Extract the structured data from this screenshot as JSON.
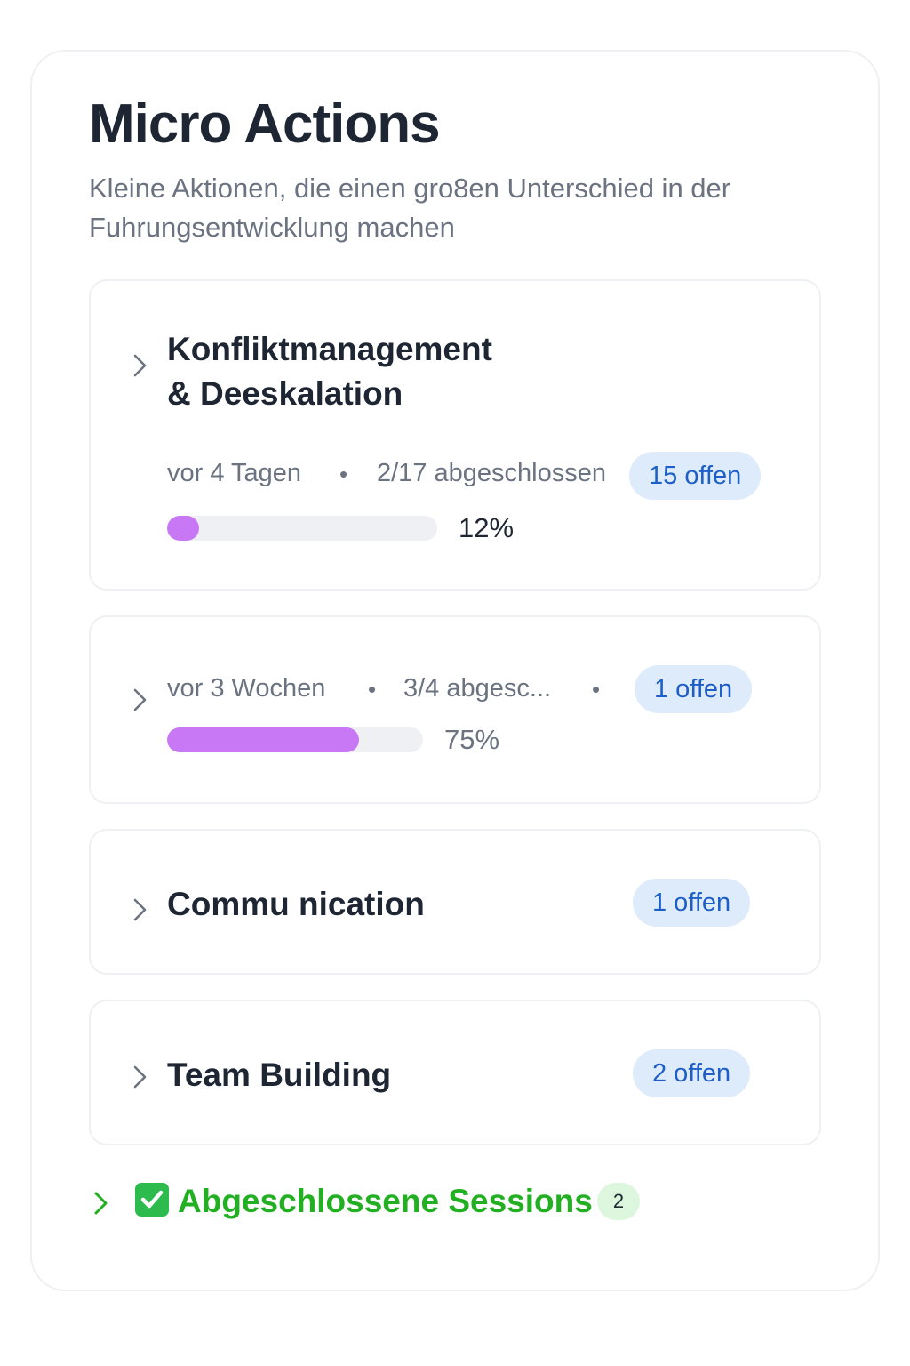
{
  "header": {
    "title": "Micro Actions",
    "subtitle": "Kleine Aktionen, die einen gro8en Unterschied in der Fuhrungsentwicklung machen"
  },
  "sessions": [
    {
      "title_line1": "Konfliktmanagement",
      "title_line2": "& Deeskalation",
      "time": "vor 4 Tagen",
      "separator": "•",
      "completed": "2/17 abgeschlossen",
      "open_badge": "15 offen",
      "progress": 0.12,
      "progress_label": "12%"
    },
    {
      "time": "vor 3 Wochen",
      "separator": "•",
      "completed": "3/4 abgesc...",
      "open_badge": "1 offen",
      "progress": 0.75,
      "progress_label": "75%"
    },
    {
      "title": "Commu nication",
      "open_badge": "1 offen"
    },
    {
      "title": "Team Building",
      "open_badge": "2 offen"
    }
  ],
  "completed_section": {
    "label": "Abgeschlossene Sessions",
    "count": "2",
    "icon": "check-box-icon"
  },
  "colors": {
    "accent_progress": "#c978f5",
    "badge_bg": "#deebfb",
    "badge_text": "#1d5fc7",
    "success": "#22b022"
  }
}
